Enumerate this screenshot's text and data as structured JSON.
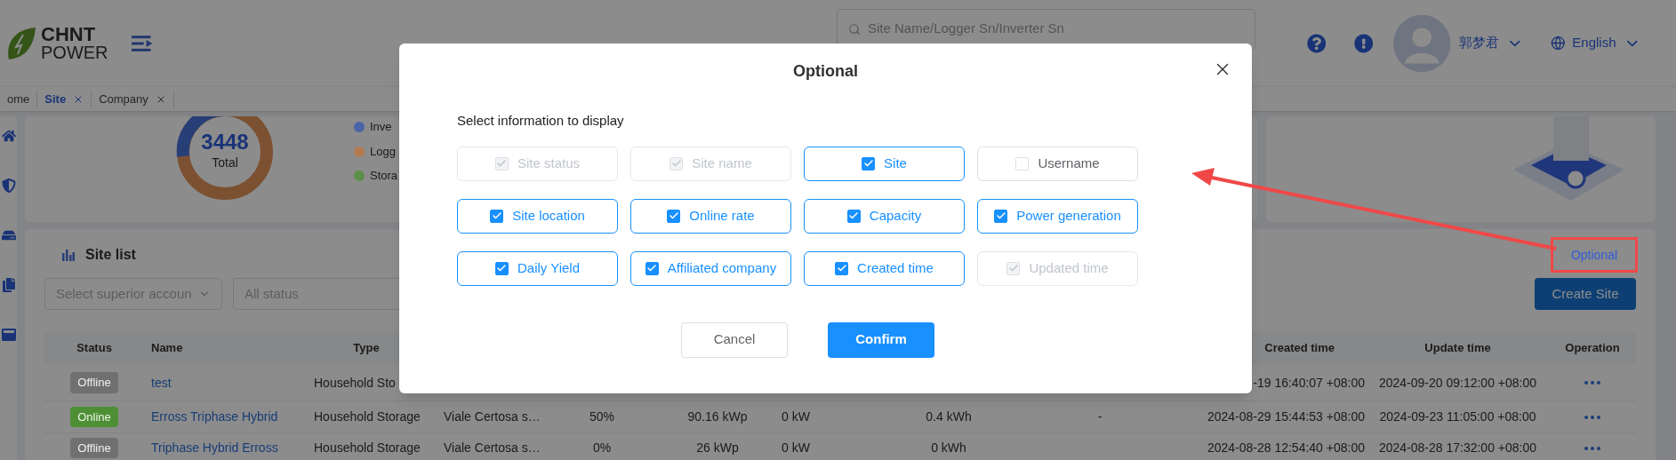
{
  "header": {
    "logo": {
      "line1": "CHNT",
      "line2": "POWER"
    },
    "search": {
      "placeholder": "Site Name/Logger Sn/Inverter Sn"
    },
    "user": {
      "name": "郭梦君"
    },
    "language": {
      "label": "English"
    }
  },
  "tabs": [
    {
      "label": "ome",
      "selected": false,
      "closable": false
    },
    {
      "label": "Site",
      "selected": true,
      "closable": true
    },
    {
      "label": "Company",
      "selected": false,
      "closable": true
    }
  ],
  "summary": {
    "total": "3448",
    "total_label": "Total",
    "legend": [
      {
        "label": "Inve",
        "color": "#4a64a8"
      },
      {
        "label": "Logg",
        "color": "#b4794f"
      },
      {
        "label": "Stora",
        "color": "#5c8f48"
      }
    ]
  },
  "site_list": {
    "title": "Site list",
    "filters": [
      {
        "placeholder": "Select  superior accoun",
        "kind": "select"
      },
      {
        "placeholder": "All status",
        "kind": "input"
      }
    ],
    "optional_link": "Optional",
    "create_button": "Create Site",
    "columns": [
      "Status",
      "Name",
      "Type",
      "Created time",
      "Update time",
      "Operation"
    ],
    "rows": [
      {
        "status": {
          "label": "Offline",
          "kind": "offline"
        },
        "name": "test",
        "type": "Household Sto",
        "created_time": "-19 16:40:07 +08:00",
        "update_time": "2024-09-20 09:12:00 +08:00"
      },
      {
        "status": {
          "label": "Online",
          "kind": "online"
        },
        "name": "Erross Triphase Hybrid",
        "type": "Household Storage",
        "column_4": "Viale Certosa s…",
        "column_5": "50%",
        "column_6": "90.16 kWp",
        "column_7": "0 kW",
        "column_8": "0.4 kWh",
        "column_9": "-",
        "created_time": "2024-08-29 15:44:53 +08:00",
        "update_time": "2024-09-23 11:05:00 +08:00"
      },
      {
        "status": {
          "label": "Offline",
          "kind": "offline"
        },
        "name": "Triphase Hybrid Erross",
        "type": "Household Storage",
        "column_4": "Viale Certosa s…",
        "column_5": "0%",
        "column_6": "26 kWp",
        "column_7": "0 kW",
        "column_8": "0 kWh",
        "created_time": "2024-08-28 12:54:40 +08:00",
        "update_time": "2024-08-28 17:32:00 +08:00"
      }
    ]
  },
  "dialog": {
    "title": "Optional",
    "prompt": "Select information to display",
    "options": [
      {
        "label": "Site status",
        "checked": true,
        "disabled": true
      },
      {
        "label": "Site name",
        "checked": true,
        "disabled": true
      },
      {
        "label": "Site",
        "checked": true,
        "disabled": false
      },
      {
        "label": "Username",
        "checked": false,
        "disabled": false
      },
      {
        "label": "Site location",
        "checked": true,
        "disabled": false
      },
      {
        "label": "Online rate",
        "checked": true,
        "disabled": false
      },
      {
        "label": "Capacity",
        "checked": true,
        "disabled": false
      },
      {
        "label": "Power generation",
        "checked": true,
        "disabled": false
      },
      {
        "label": "Daily Yield",
        "checked": true,
        "disabled": false
      },
      {
        "label": "Affiliated company",
        "checked": true,
        "disabled": false
      },
      {
        "label": "Created time",
        "checked": true,
        "disabled": false
      },
      {
        "label": "Updated time",
        "checked": true,
        "disabled": true
      }
    ],
    "cancel": "Cancel",
    "confirm": "Confirm"
  }
}
